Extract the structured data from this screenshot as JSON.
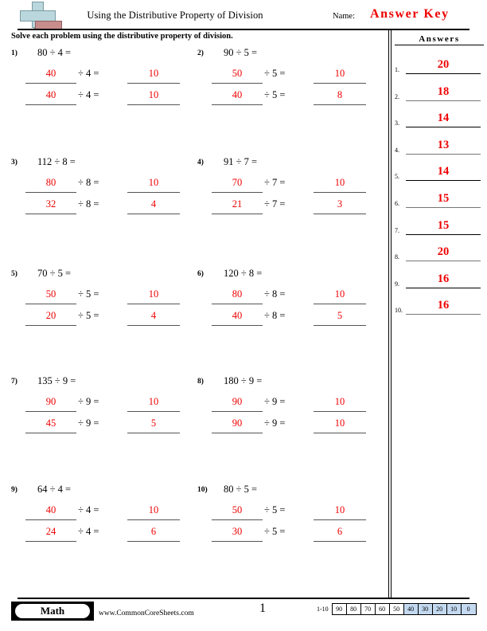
{
  "header": {
    "title": "Using the Distributive Property of Division",
    "name_label": "Name:",
    "answer_key": "Answer Key",
    "logo_icon": "math-cross-logo"
  },
  "instructions": "Solve each problem using the distributive property of division.",
  "answers_panel": {
    "title": "Answers",
    "items": [
      {
        "num": "1.",
        "value": "20"
      },
      {
        "num": "2.",
        "value": "18"
      },
      {
        "num": "3.",
        "value": "14"
      },
      {
        "num": "4.",
        "value": "13"
      },
      {
        "num": "5.",
        "value": "14"
      },
      {
        "num": "6.",
        "value": "15"
      },
      {
        "num": "7.",
        "value": "15"
      },
      {
        "num": "8.",
        "value": "20"
      },
      {
        "num": "9.",
        "value": "16"
      },
      {
        "num": "10.",
        "value": "16"
      }
    ]
  },
  "problems": [
    {
      "num": "1)",
      "expression": "80 ÷ 4 =",
      "step1": {
        "part": "40",
        "op": "÷ 4 =",
        "result": "10"
      },
      "step2": {
        "part": "40",
        "op": "÷ 4 =",
        "result": "10"
      }
    },
    {
      "num": "2)",
      "expression": "90 ÷ 5 =",
      "step1": {
        "part": "50",
        "op": "÷ 5 =",
        "result": "10"
      },
      "step2": {
        "part": "40",
        "op": "÷ 5 =",
        "result": "8"
      }
    },
    {
      "num": "3)",
      "expression": "112 ÷ 8 =",
      "step1": {
        "part": "80",
        "op": "÷ 8 =",
        "result": "10"
      },
      "step2": {
        "part": "32",
        "op": "÷ 8 =",
        "result": "4"
      }
    },
    {
      "num": "4)",
      "expression": "91 ÷ 7 =",
      "step1": {
        "part": "70",
        "op": "÷ 7 =",
        "result": "10"
      },
      "step2": {
        "part": "21",
        "op": "÷ 7 =",
        "result": "3"
      }
    },
    {
      "num": "5)",
      "expression": "70 ÷ 5 =",
      "step1": {
        "part": "50",
        "op": "÷ 5 =",
        "result": "10"
      },
      "step2": {
        "part": "20",
        "op": "÷ 5 =",
        "result": "4"
      }
    },
    {
      "num": "6)",
      "expression": "120 ÷ 8 =",
      "step1": {
        "part": "80",
        "op": "÷ 8 =",
        "result": "10"
      },
      "step2": {
        "part": "40",
        "op": "÷ 8 =",
        "result": "5"
      }
    },
    {
      "num": "7)",
      "expression": "135 ÷ 9 =",
      "step1": {
        "part": "90",
        "op": "÷ 9 =",
        "result": "10"
      },
      "step2": {
        "part": "45",
        "op": "÷ 9 =",
        "result": "5"
      }
    },
    {
      "num": "8)",
      "expression": "180 ÷ 9 =",
      "step1": {
        "part": "90",
        "op": "÷ 9 =",
        "result": "10"
      },
      "step2": {
        "part": "90",
        "op": "÷ 9 =",
        "result": "10"
      }
    },
    {
      "num": "9)",
      "expression": "64 ÷ 4 =",
      "step1": {
        "part": "40",
        "op": "÷ 4 =",
        "result": "10"
      },
      "step2": {
        "part": "24",
        "op": "÷ 4 =",
        "result": "6"
      }
    },
    {
      "num": "10)",
      "expression": "80 ÷ 5 =",
      "step1": {
        "part": "50",
        "op": "÷ 5 =",
        "result": "10"
      },
      "step2": {
        "part": "30",
        "op": "÷ 5 =",
        "result": "6"
      }
    }
  ],
  "footer": {
    "subject_badge": "Math",
    "website": "www.CommonCoreSheets.com",
    "page_number": "1",
    "score_scale": {
      "range_label": "1-10",
      "boxes": [
        {
          "label": "90",
          "highlighted": false
        },
        {
          "label": "80",
          "highlighted": false
        },
        {
          "label": "70",
          "highlighted": false
        },
        {
          "label": "60",
          "highlighted": false
        },
        {
          "label": "50",
          "highlighted": false
        },
        {
          "label": "40",
          "highlighted": true
        },
        {
          "label": "30",
          "highlighted": true
        },
        {
          "label": "20",
          "highlighted": true
        },
        {
          "label": "10",
          "highlighted": true
        },
        {
          "label": "0",
          "highlighted": true
        }
      ]
    }
  },
  "colors": {
    "answer_red": "#ee0000",
    "highlight_blue": "#c3d9f0",
    "logo_teal": "#b9d7dd",
    "logo_salmon": "#c98c8c"
  }
}
